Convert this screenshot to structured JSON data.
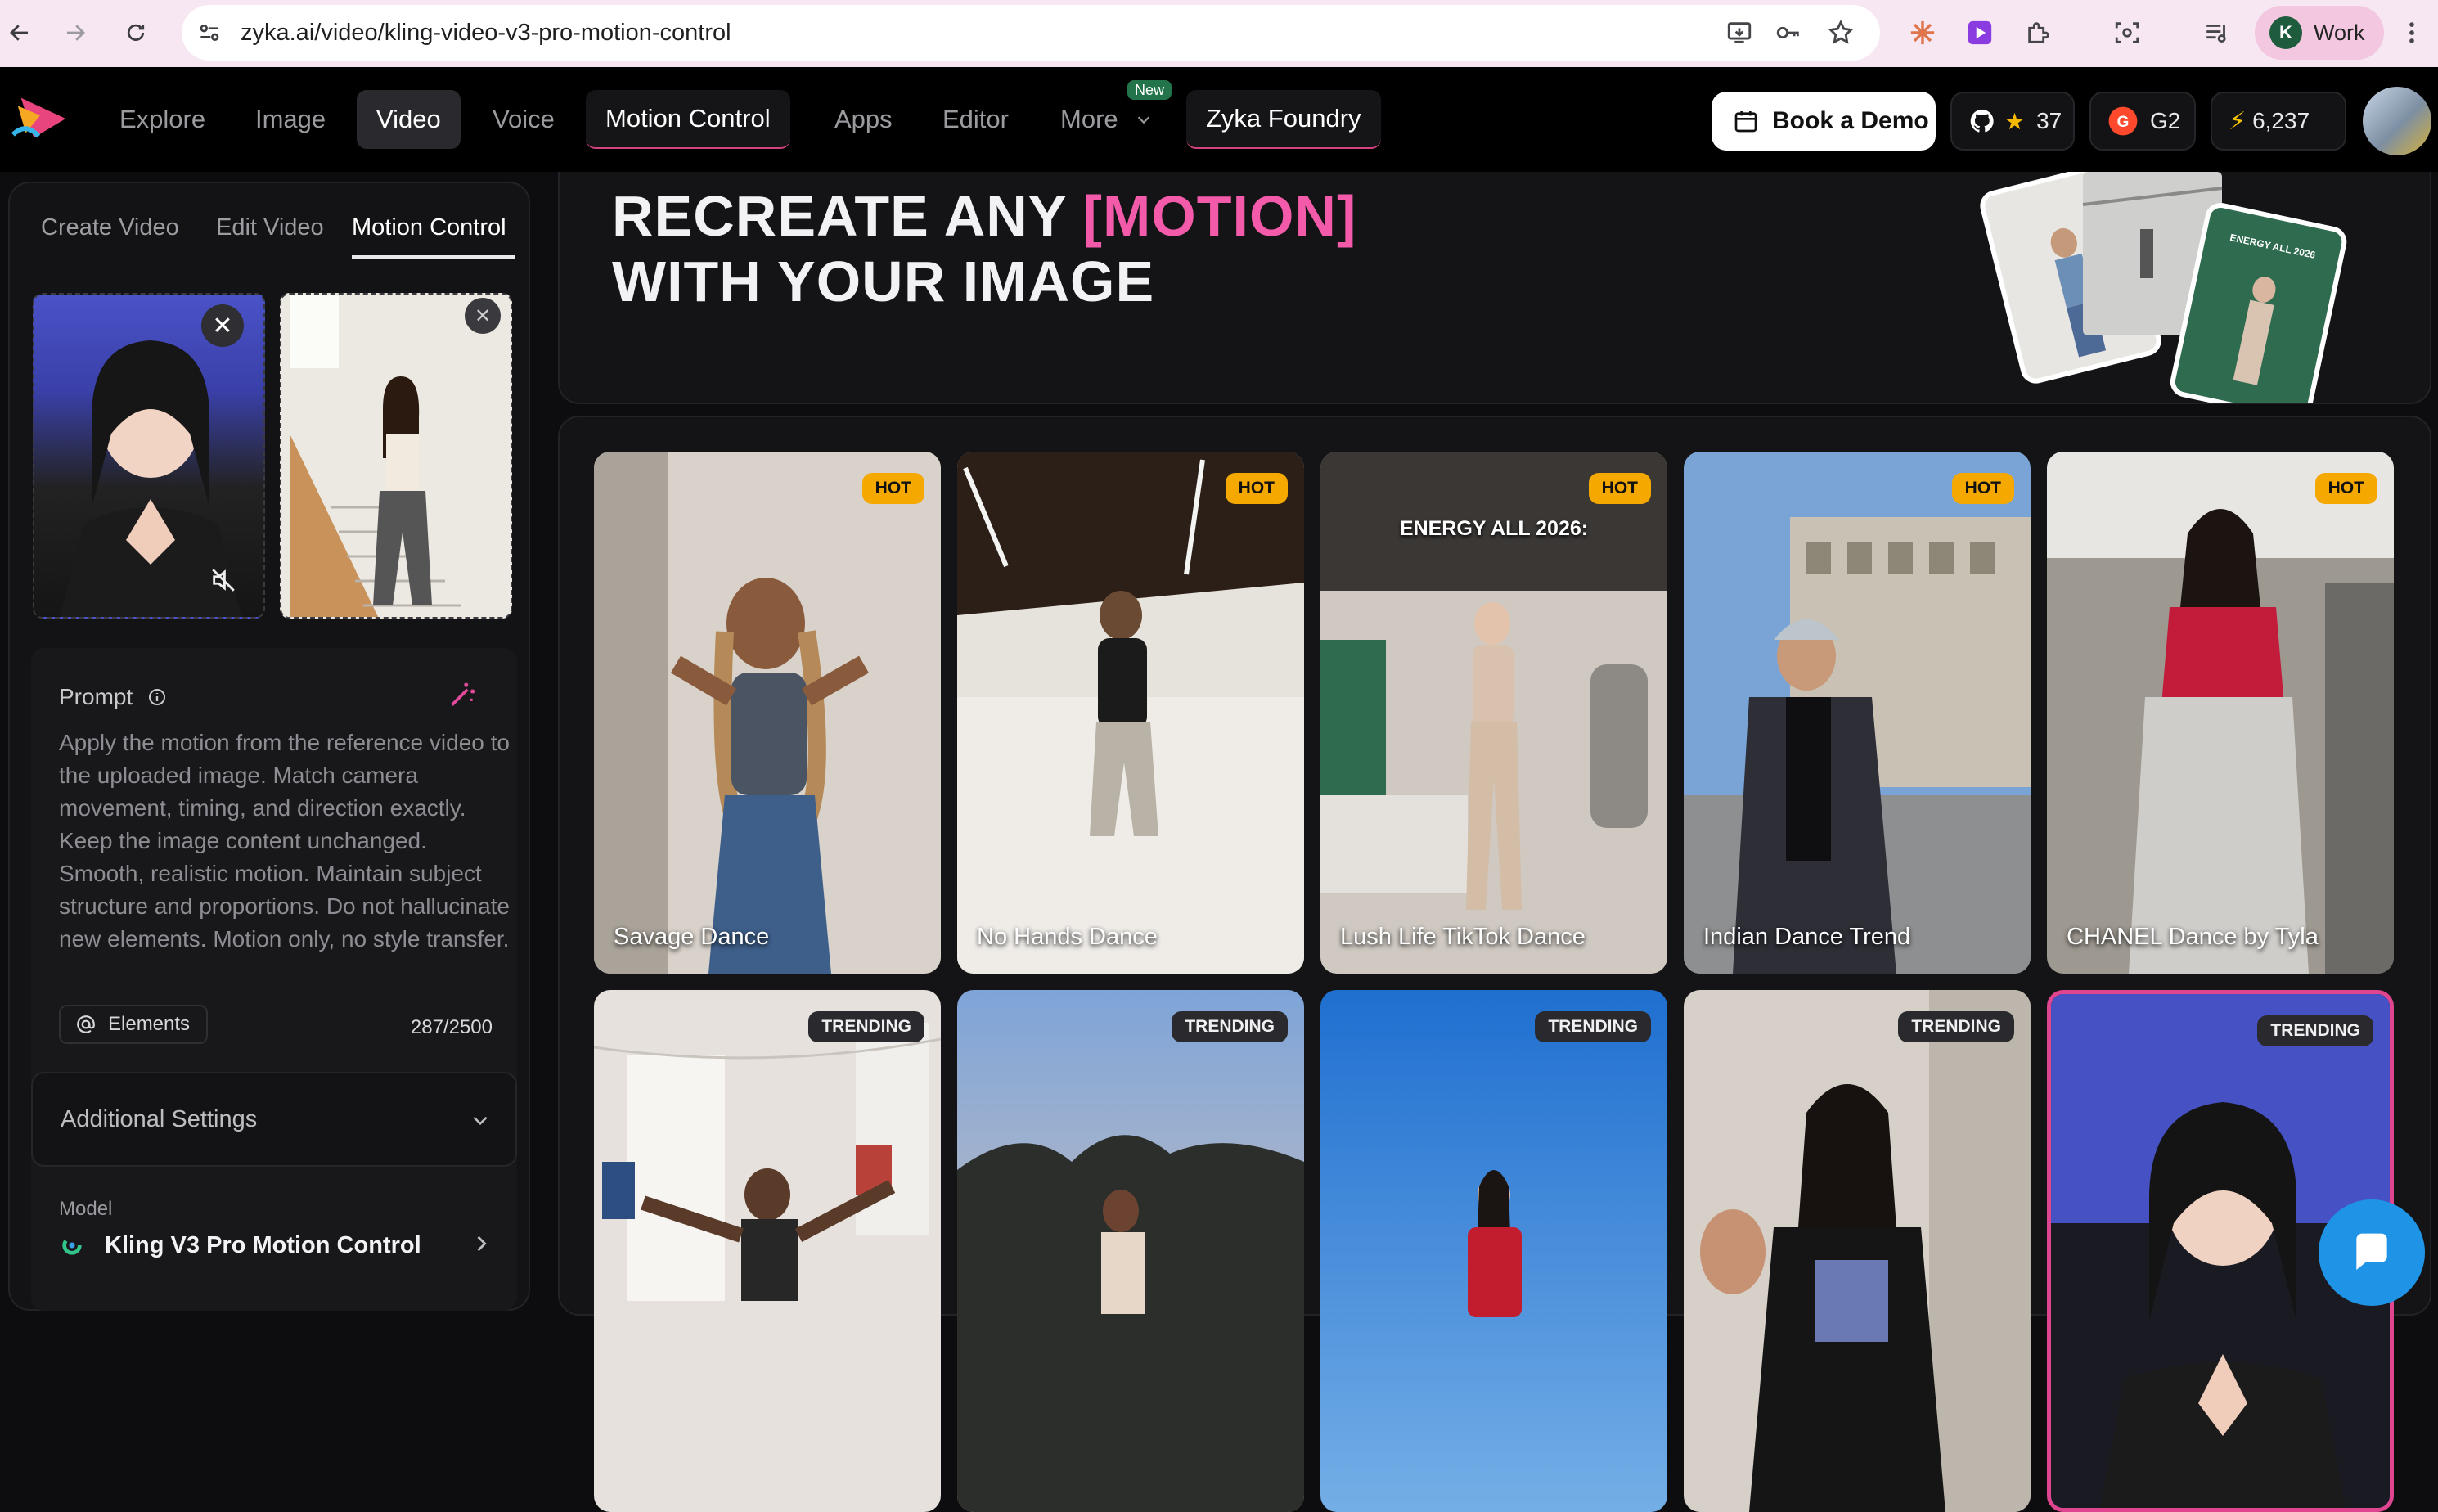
{
  "browser": {
    "url": "zyka.ai/video/kling-video-v3-pro-motion-control",
    "profile_label": "Work",
    "profile_initial": "K"
  },
  "appnav": {
    "items": [
      {
        "label": "Explore"
      },
      {
        "label": "Image"
      },
      {
        "label": "Video"
      },
      {
        "label": "Voice"
      },
      {
        "label": "Motion Control"
      },
      {
        "label": "Apps"
      },
      {
        "label": "Editor"
      },
      {
        "label": "More"
      },
      {
        "label": "Zyka Foundry"
      }
    ],
    "new_badge": "New",
    "book_demo": "Book a Demo",
    "github_stars": "37",
    "g2_label": "G2",
    "credits": "6,237"
  },
  "sidebar": {
    "tabs": [
      {
        "label": "Create Video"
      },
      {
        "label": "Edit Video"
      },
      {
        "label": "Motion Control"
      }
    ],
    "prompt_title": "Prompt",
    "prompt_text": "Apply the motion from the reference video to the uploaded image. Match camera movement, timing, and direction exactly. Keep the image content unchanged. Smooth, realistic motion. Maintain subject structure and proportions. Do not hallucinate new elements. Motion only, no style transfer.",
    "elements_label": "Elements",
    "char_count": "287/2500",
    "additional_settings": "Additional Settings",
    "model_label": "Model",
    "model_value": "Kling V3 Pro Motion Control"
  },
  "hero": {
    "line1_prefix": "RECREATE ANY ",
    "line1_highlight": "[MOTION]",
    "line2": "WITH YOUR IMAGE",
    "collage_caption": "ENERGY ALL 2026"
  },
  "gallery": {
    "row1": [
      {
        "title": "Savage Dance",
        "badge": "HOT"
      },
      {
        "title": "No Hands Dance",
        "badge": "HOT"
      },
      {
        "title": "Lush Life TikTok Dance",
        "badge": "HOT",
        "caption": "ENERGY ALL 2026:"
      },
      {
        "title": "Indian Dance Trend",
        "badge": "HOT"
      },
      {
        "title": "CHANEL Dance by Tyla",
        "badge": "HOT"
      }
    ],
    "row2": [
      {
        "badge": "TRENDING"
      },
      {
        "badge": "TRENDING"
      },
      {
        "badge": "TRENDING"
      },
      {
        "badge": "TRENDING"
      },
      {
        "badge": "TRENDING"
      }
    ]
  },
  "colors": {
    "accent_pink": "#f35aa9",
    "hot_badge": "#f5a800",
    "chat_button": "#1f94e6",
    "selected_card_border": "#e0468f"
  }
}
